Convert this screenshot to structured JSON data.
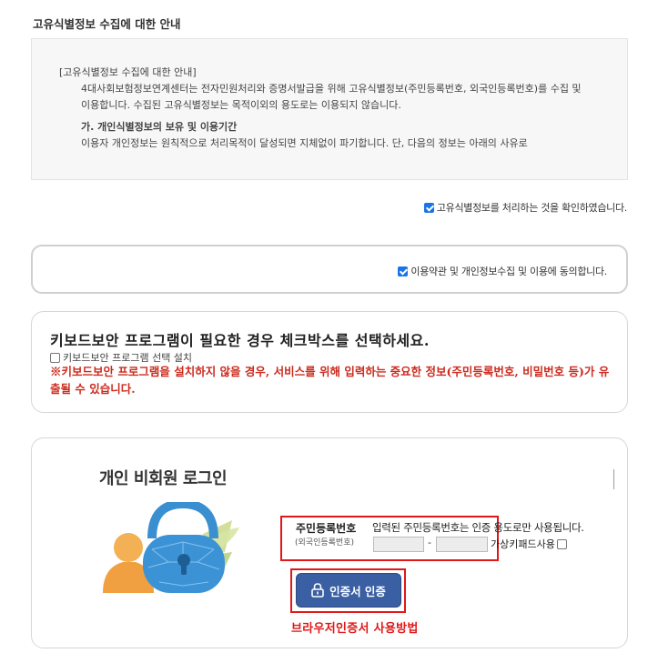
{
  "notice": {
    "section_title": "고유식별정보 수집에 대한 안내",
    "bracket_title": "[고유식별정보 수집에 대한 안내]",
    "body": "4대사회보험정보연계센터는 전자민원처리와 증명서발급을 위해 고유식별정보(주민등록번호, 외국인등록번호)를 수집 및 이용합니다. 수집된 고유식별정보는 목적이외의 용도로는 이용되지 않습니다.",
    "subheading": "가. 개인식별정보의 보유 및 이용기간",
    "cut_line": "이용자 개인정보는 원칙적으로 처리목적이 달성되면 지체없이 파기합니다. 단, 다음의 정보는 아래의 사유로"
  },
  "confirm": {
    "label": "고유식별정보를 처리하는 것을 확인하였습니다.",
    "checked": true
  },
  "agree": {
    "label": "이용약관 및 개인정보수집 및 이용에 동의합니다.",
    "checked": true
  },
  "keyboard": {
    "title": "키보드보안 프로그램이 필요한 경우 체크박스를 선택하세요.",
    "checkbox_label": "키보드보안 프로그램 선택 설치",
    "warning": "※키보드보안 프로그램을 설치하지 않을 경우, 서비스를 위해 입력하는 중요한 정보(주민등록번호, 비밀번호 등)가 유출될 수 있습니다."
  },
  "login": {
    "title": "개인 비회원 로그인",
    "id_label": "주민등록번호",
    "id_sub_label": "(외국인등록번호)",
    "id_note": "입력된 주민등록번호는 인증 용도로만 사용됩니다.",
    "dash": "-",
    "virtual_keypad_label": "가상키패드사용",
    "cert_button_label": "인증서 인증",
    "browser_cert_link": "브라우저인증서 사용방법"
  },
  "colors": {
    "accent_blue": "#1a73e8",
    "cert_button": "#3a5fa3",
    "warning_red": "#cc2b1e",
    "highlight_red": "#e01818"
  }
}
